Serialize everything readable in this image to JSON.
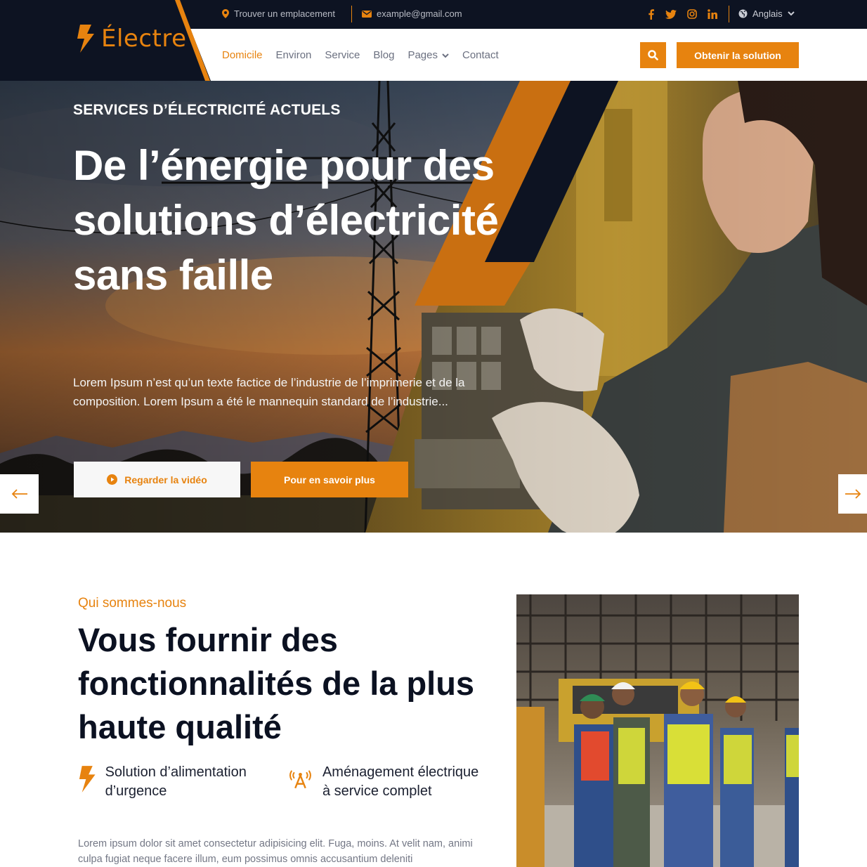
{
  "topbar": {
    "location": "Trouver un emplacement",
    "email": "example@gmail.com",
    "social_icons": [
      "facebook-icon",
      "twitter-icon",
      "instagram-icon",
      "linkedin-icon"
    ],
    "language": "Anglais"
  },
  "brand": {
    "name": "Électre",
    "accent": "#e7830f",
    "dark": "#0d1322"
  },
  "nav": {
    "items": [
      "Domicile",
      "Environ",
      "Service",
      "Blog",
      "Pages",
      "Contact"
    ],
    "active": "Domicile",
    "cta": "Obtenir la solution"
  },
  "hero": {
    "eyebrow": "SERVICES D’ÉLECTRICITÉ ACTUELS",
    "title": "De l’énergie pour des solutions d’électricité sans faille",
    "text": "Lorem Ipsum n’est qu’un texte factice de l’industrie de l’imprimerie et de la composition. Lorem Ipsum a été le mannequin standard de l’industrie...",
    "video_button": "Regarder la vidéo",
    "more_button": "Pour en savoir plus"
  },
  "about": {
    "kicker": "Qui sommes-nous",
    "title": "Vous fournir des fonctionnalités de la plus haute qualité",
    "features": [
      {
        "icon": "lightning-icon",
        "label": "Solution d’alimentation d’urgence"
      },
      {
        "icon": "antenna-icon",
        "label": "Aménagement électrique à service complet"
      }
    ],
    "text": "Lorem ipsum dolor sit amet consectetur adipisicing elit. Fuga, moins. At velit nam, animi culpa fugiat neque facere illum, eum possimus omnis accusantium deleniti"
  }
}
